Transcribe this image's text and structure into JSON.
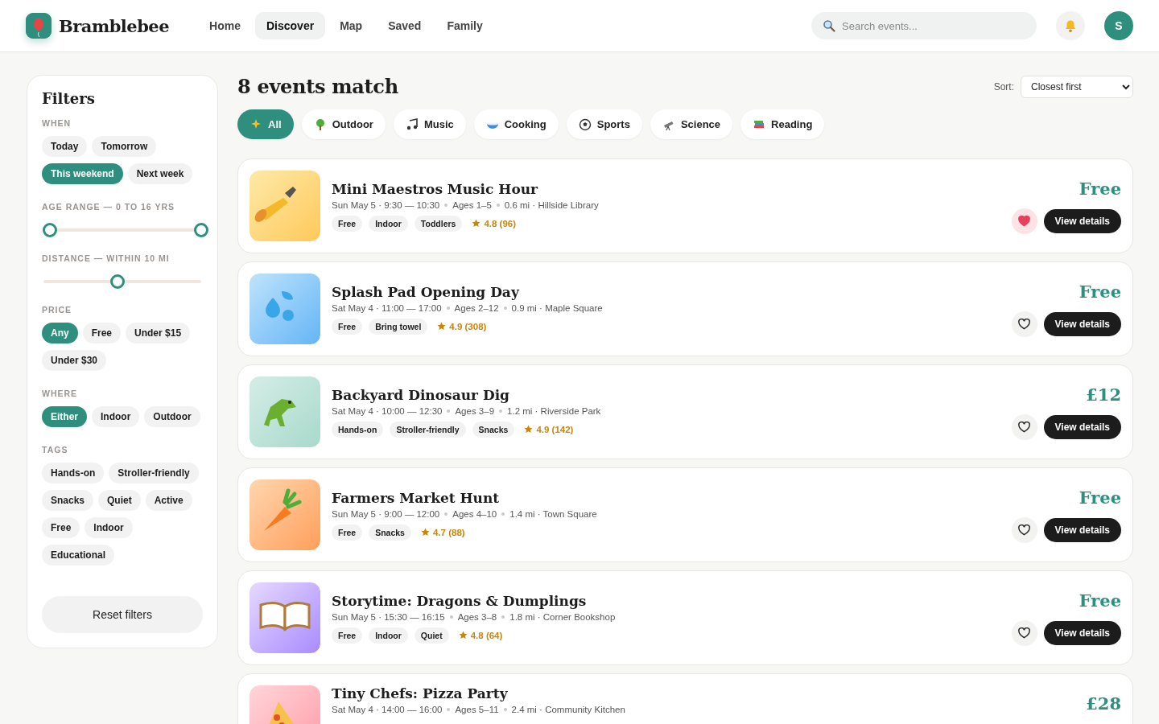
{
  "brand": "Bramblebee",
  "nav": [
    {
      "label": "Home",
      "selected": false
    },
    {
      "label": "Discover",
      "selected": true
    },
    {
      "label": "Map",
      "selected": false
    },
    {
      "label": "Saved",
      "selected": false
    },
    {
      "label": "Family",
      "selected": false
    }
  ],
  "search": {
    "placeholder": "Search events..."
  },
  "avatar": "S",
  "filters": {
    "title": "Filters",
    "groups": [
      {
        "kind": "chips",
        "label": "WHEN",
        "options": [
          {
            "label": "Today",
            "selected": false
          },
          {
            "label": "Tomorrow",
            "selected": false
          },
          {
            "label": "This weekend",
            "selected": true
          },
          {
            "label": "Next week",
            "selected": false
          }
        ]
      },
      {
        "kind": "range",
        "label": "AGE RANGE — 0 TO 16 YRS",
        "thumbs": [
          {
            "level": 0.04
          },
          {
            "level": 1
          }
        ]
      },
      {
        "kind": "slider",
        "label": "DISTANCE — WITHIN 10 MI",
        "level": 0.47
      },
      {
        "kind": "chips",
        "label": "PRICE",
        "options": [
          {
            "label": "Any",
            "selected": true
          },
          {
            "label": "Free",
            "selected": false
          },
          {
            "label": "Under $15",
            "selected": false
          },
          {
            "label": "Under $30",
            "selected": false
          }
        ]
      },
      {
        "kind": "chips",
        "label": "WHERE",
        "options": [
          {
            "label": "Either",
            "selected": true
          },
          {
            "label": "Indoor",
            "selected": false
          },
          {
            "label": "Outdoor",
            "selected": false
          }
        ]
      },
      {
        "kind": "chips",
        "label": "TAGS",
        "options": [
          {
            "label": "Hands-on",
            "selected": false
          },
          {
            "label": "Stroller-friendly",
            "selected": false
          },
          {
            "label": "Snacks",
            "selected": false
          },
          {
            "label": "Quiet",
            "selected": false
          },
          {
            "label": "Active",
            "selected": false
          },
          {
            "label": "Free",
            "selected": false
          },
          {
            "label": "Indoor",
            "selected": false
          },
          {
            "label": "Educational",
            "selected": false
          }
        ]
      }
    ],
    "reset": "Reset filters"
  },
  "results": {
    "heading": "8 events match",
    "sort_label": "Sort:",
    "sort_value": "Closest first",
    "categories": [
      {
        "label": "All",
        "selected": true
      },
      {
        "label": "Outdoor",
        "selected": false
      },
      {
        "label": "Music",
        "selected": false
      },
      {
        "label": "Cooking",
        "selected": false
      },
      {
        "label": "Sports",
        "selected": false
      },
      {
        "label": "Science",
        "selected": false
      },
      {
        "label": "Reading",
        "selected": false
      }
    ],
    "events": [
      {
        "title": "Mini Maestros Music Hour",
        "when": "Sun May 5 · 9:30 — 10:30",
        "ages": "Ages 1–5",
        "place": "0.6 mi · Hillside Library",
        "tags": [
          "Free",
          "Indoor",
          "Toddlers"
        ],
        "rating": "4.8 (96)",
        "price": "Free",
        "saved": true,
        "action": "View details"
      },
      {
        "title": "Splash Pad Opening Day",
        "when": "Sat May 4 · 11:00 — 17:00",
        "ages": "Ages 2–12",
        "place": "0.9 mi · Maple Square",
        "tags": [
          "Free",
          "Bring towel"
        ],
        "rating": "4.9 (308)",
        "price": "Free",
        "saved": false,
        "action": "View details"
      },
      {
        "title": "Backyard Dinosaur Dig",
        "when": "Sat May 4 · 10:00 — 12:30",
        "ages": "Ages 3–9",
        "place": "1.2 mi · Riverside Park",
        "tags": [
          "Hands-on",
          "Stroller-friendly",
          "Snacks"
        ],
        "rating": "4.9 (142)",
        "price": "£12",
        "saved": false,
        "action": "View details"
      },
      {
        "title": "Farmers Market Hunt",
        "when": "Sun May 5 · 9:00 — 12:00",
        "ages": "Ages 4–10",
        "place": "1.4 mi · Town Square",
        "tags": [
          "Free",
          "Snacks"
        ],
        "rating": "4.7 (88)",
        "price": "Free",
        "saved": false,
        "action": "View details"
      },
      {
        "title": "Storytime: Dragons & Dumplings",
        "when": "Sun May 5 · 15:30 — 16:15",
        "ages": "Ages 3–8",
        "place": "1.8 mi · Corner Bookshop",
        "tags": [
          "Free",
          "Indoor",
          "Quiet"
        ],
        "rating": "4.8 (64)",
        "price": "Free",
        "saved": false,
        "action": "View details"
      },
      {
        "title": "Tiny Chefs: Pizza Party",
        "when": "Sat May 4 · 14:00 — 16:00",
        "ages": "Ages 5–11",
        "place": "2.4 mi · Community Kitchen",
        "price": "£28"
      }
    ]
  }
}
